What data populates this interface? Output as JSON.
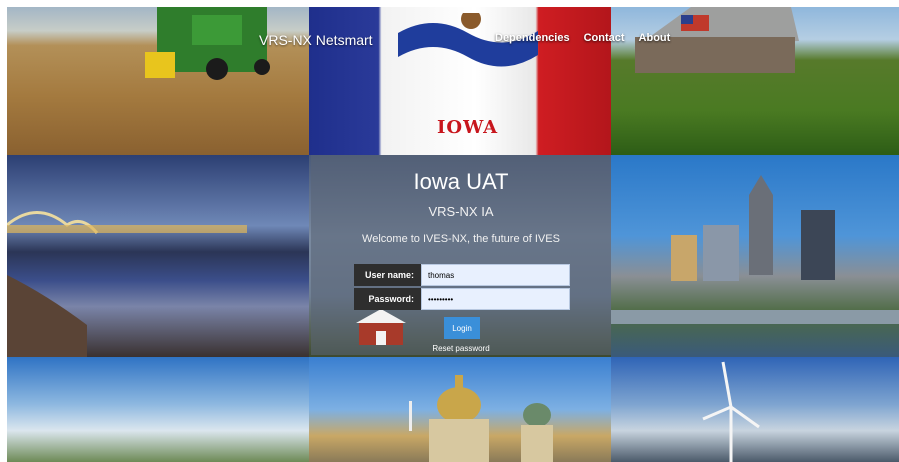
{
  "nav": {
    "brand": "VRS-NX Netsmart",
    "links": [
      "Dependencies",
      "Contact",
      "About"
    ]
  },
  "flag": {
    "word": "IOWA"
  },
  "login": {
    "title": "Iowa UAT",
    "subtitle": "VRS-NX IA",
    "welcome": "Welcome to IVES-NX, the future of IVES",
    "username_label": "User name:",
    "username_value": "thomas",
    "password_label": "Password:",
    "password_value": "•••••••••",
    "login_button": "Login",
    "reset_link": "Reset password"
  },
  "colors": {
    "login_button": "#3a8fd9",
    "label_bg": "#2e2e2e",
    "flag_red": "#c8161d",
    "flag_blue": "#1f2f8c"
  }
}
